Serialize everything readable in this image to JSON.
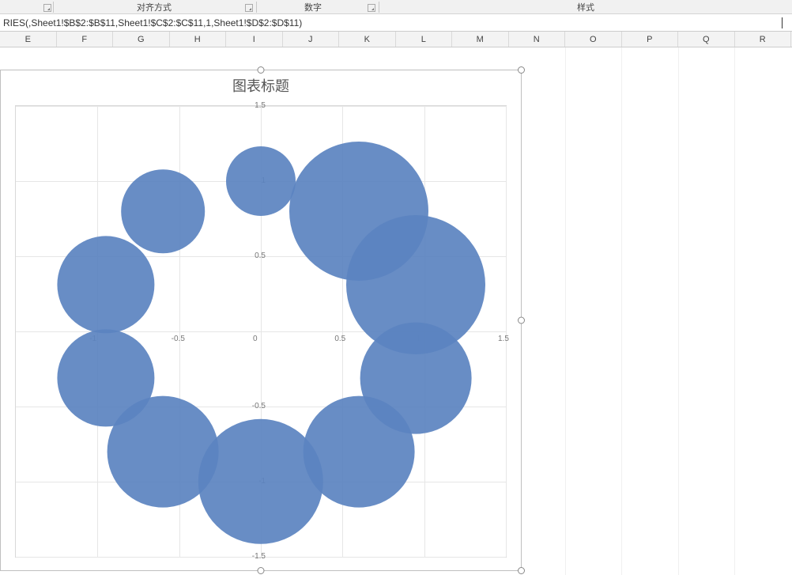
{
  "ribbon": {
    "group_align": "对齐方式",
    "group_number": "数字",
    "group_styles": "样式"
  },
  "formula_bar": {
    "text": "RIES(,Sheet1!$B$2:$B$11,Sheet1!$C$2:$C$11,1,Sheet1!$D$2:$D$11)"
  },
  "columns": [
    "E",
    "F",
    "G",
    "H",
    "I",
    "J",
    "K",
    "L",
    "M",
    "N",
    "O",
    "P",
    "Q",
    "R"
  ],
  "chart": {
    "title": "图表标题"
  },
  "chart_data": {
    "type": "bubble",
    "title": "图表标题",
    "xlabel": "",
    "ylabel": "",
    "xlim": [
      -1.5,
      1.5
    ],
    "ylim": [
      -1.5,
      1.5
    ],
    "x_ticks": [
      -1,
      -0.5,
      0,
      0.5,
      1,
      1.5
    ],
    "y_ticks": [
      -1.5,
      -1,
      -0.5,
      0,
      0.5,
      1,
      1.5
    ],
    "grid": true,
    "series": [
      {
        "name": "",
        "color": "#5b83c0",
        "points": [
          {
            "x": -0.95,
            "y": 0.31,
            "size": 2.8
          },
          {
            "x": -0.6,
            "y": 0.8,
            "size": 2.4
          },
          {
            "x": 0.0,
            "y": 1.0,
            "size": 2.0
          },
          {
            "x": 0.6,
            "y": 0.8,
            "size": 4.0
          },
          {
            "x": 0.95,
            "y": 0.31,
            "size": 4.0
          },
          {
            "x": 0.95,
            "y": -0.31,
            "size": 3.2
          },
          {
            "x": 0.6,
            "y": -0.8,
            "size": 3.2
          },
          {
            "x": 0.0,
            "y": -1.0,
            "size": 3.6
          },
          {
            "x": -0.6,
            "y": -0.8,
            "size": 3.2
          },
          {
            "x": -0.95,
            "y": -0.31,
            "size": 2.8
          }
        ]
      }
    ]
  }
}
